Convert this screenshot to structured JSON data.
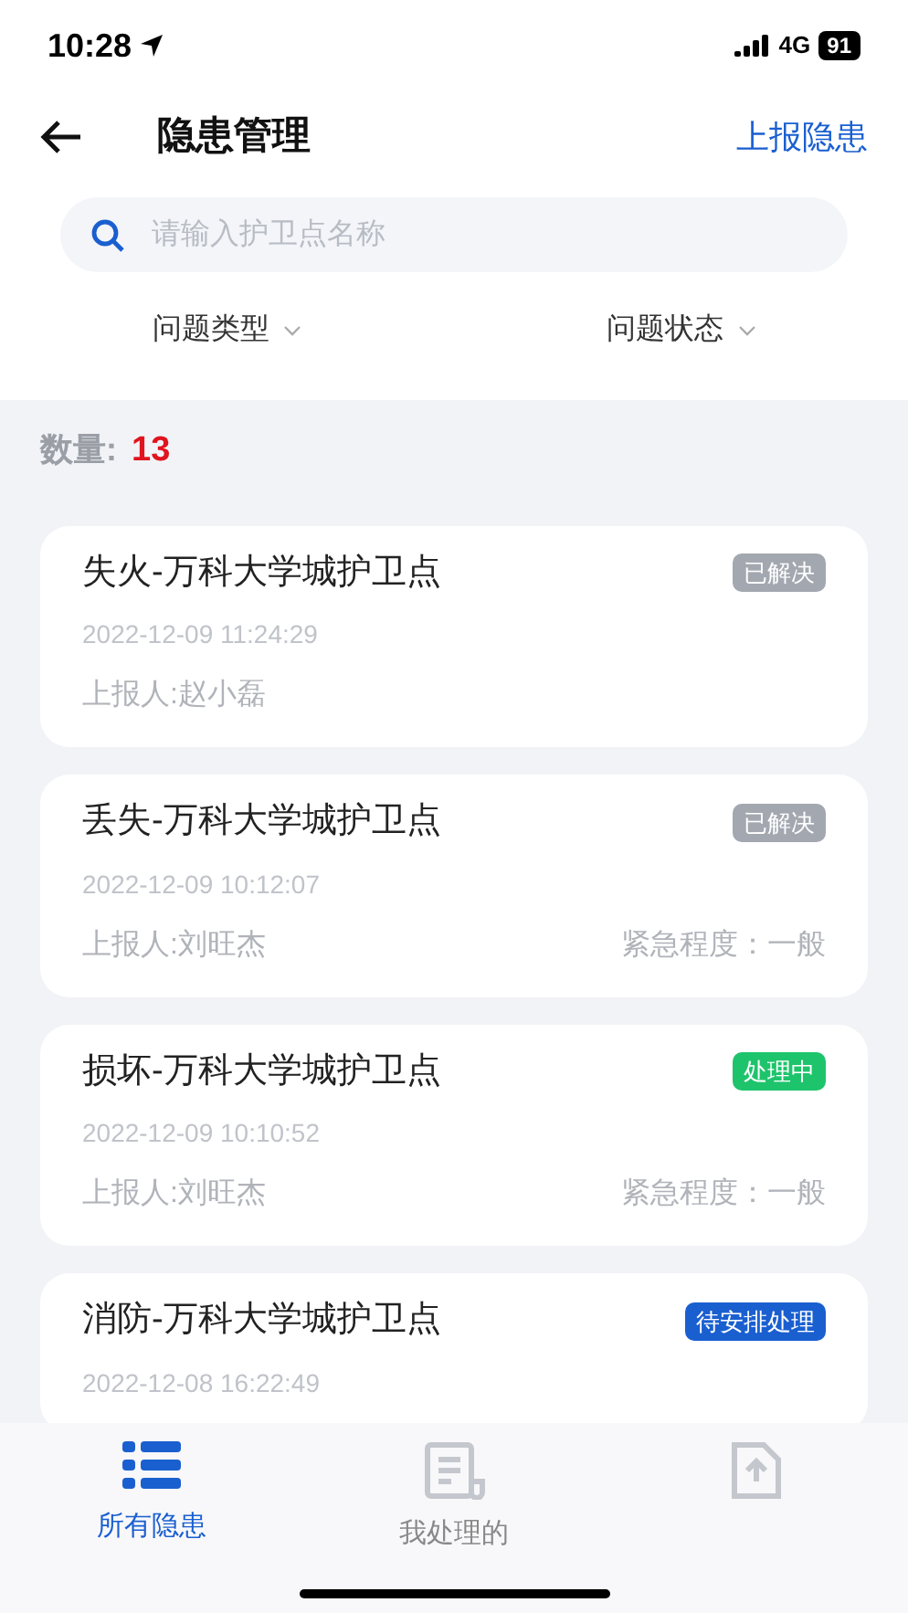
{
  "status_bar": {
    "time": "10:28",
    "network": "4G",
    "battery": "91"
  },
  "nav": {
    "title": "隐患管理",
    "action": "上报隐患"
  },
  "search": {
    "placeholder": "请输入护卫点名称"
  },
  "filters": [
    {
      "label": "问题类型"
    },
    {
      "label": "问题状态"
    }
  ],
  "count": {
    "label": "数量:",
    "value": "13"
  },
  "items": [
    {
      "title": "失火-万科大学城护卫点",
      "status": {
        "label": "已解决",
        "kind": "resolved"
      },
      "time": "2022-12-09 11:24:29",
      "reporter": "上报人:赵小磊"
    },
    {
      "title": "丢失-万科大学城护卫点",
      "status": {
        "label": "已解决",
        "kind": "resolved"
      },
      "time": "2022-12-09 10:12:07",
      "reporter": "上报人:刘旺杰",
      "urgency": "紧急程度：一般"
    },
    {
      "title": "损坏-万科大学城护卫点",
      "status": {
        "label": "处理中",
        "kind": "processing"
      },
      "time": "2022-12-09 10:10:52",
      "reporter": "上报人:刘旺杰",
      "urgency": "紧急程度：一般"
    },
    {
      "title": "消防-万科大学城护卫点",
      "status": {
        "label": "待安排处理",
        "kind": "pending"
      },
      "time": "2022-12-08 16:22:49"
    }
  ],
  "tabs": [
    {
      "label": "所有隐患",
      "kind": "list",
      "selected": true
    },
    {
      "label": "我处理的",
      "kind": "document",
      "selected": false
    },
    {
      "kind": "upload",
      "selected": false
    }
  ]
}
